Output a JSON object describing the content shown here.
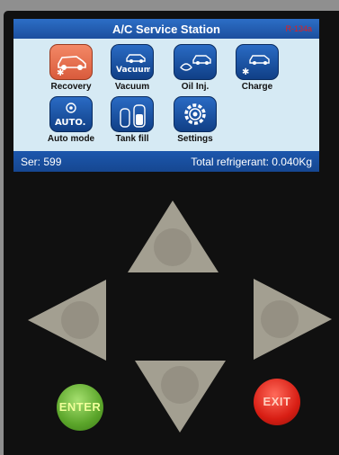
{
  "screen": {
    "title": "A/C Service Station",
    "refrigerant_type": "R-134a",
    "menu": [
      {
        "label": "Recovery",
        "icon": "recovery-icon",
        "selected": true
      },
      {
        "label": "Vacuum",
        "icon": "vacuum-icon",
        "icon_text": "Vacuum"
      },
      {
        "label": "Oil Inj.",
        "icon": "oil-injection-icon"
      },
      {
        "label": "Charge",
        "icon": "charge-icon"
      },
      {
        "label": "Auto mode",
        "icon": "auto-mode-icon",
        "icon_text": "AUTO."
      },
      {
        "label": "Tank fill",
        "icon": "tank-fill-icon"
      },
      {
        "label": "Settings",
        "icon": "settings-icon"
      }
    ],
    "status": {
      "ser": "Ser: 599",
      "total": "Total refrigerant: 0.040Kg"
    }
  },
  "keypad": {
    "up": "up-arrow-key",
    "down": "down-arrow-key",
    "left": "left-arrow-key",
    "right": "right-arrow-key",
    "enter_label": "ENTER",
    "exit_label": "EXIT"
  },
  "colors": {
    "title_bar": "#1f5bb0",
    "screen_bg": "#d6eaf4",
    "accent_selected": "#f38866",
    "enter_button": "#5ba52a",
    "exit_button": "#d81e14",
    "refrigerant_text": "#e02020"
  }
}
